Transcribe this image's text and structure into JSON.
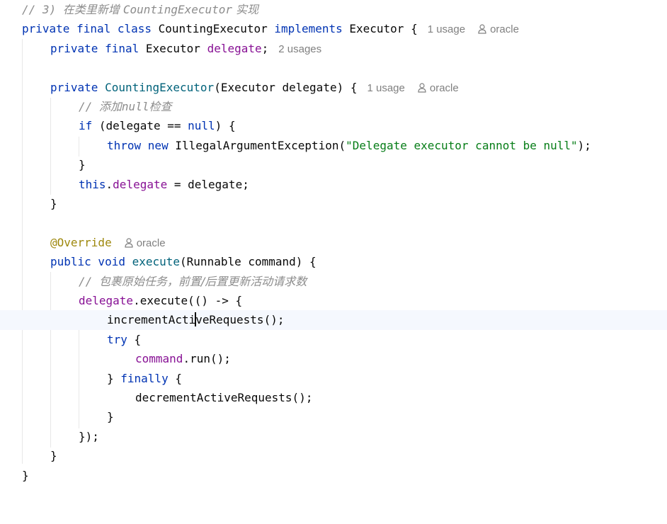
{
  "editor": {
    "lines": [
      {
        "comment": "// 3) ",
        "comment_zh_1": "在类里新增 ",
        "comment_en": "CountingExecutor",
        "comment_zh_2": " 实现"
      },
      {
        "kw1": "private final class ",
        "name": "CountingExecutor",
        "kw2": " implements ",
        "iface": "Executor",
        "brace": " {",
        "usages": "1 usage",
        "author": "oracle"
      },
      {
        "kw": "private final ",
        "type": "Executor",
        "field": "delegate",
        "semi": ";",
        "usages": "2 usages"
      },
      {},
      {
        "kw": "private ",
        "ctor": "CountingExecutor",
        "params": "(Executor delegate) {",
        "usages": "1 usage",
        "author": "oracle"
      },
      {
        "comment": "// ",
        "comment_zh_1": "添加",
        "comment_en": "null",
        "comment_zh_2": "检查"
      },
      {
        "kw": "if ",
        "p1": "(delegate == ",
        "null": "null",
        "p2": ") {"
      },
      {
        "kw": "throw new ",
        "cls": "IllegalArgumentException(",
        "str": "\"Delegate executor cannot be null\"",
        "end": ");"
      },
      {
        "text": "}"
      },
      {
        "kw": "this",
        "dot": ".",
        "field": "delegate",
        "rest": " = delegate;"
      },
      {
        "text": "}"
      },
      {},
      {
        "annotation": "@Override",
        "author": "oracle"
      },
      {
        "kw": "public void ",
        "fn": "execute",
        "params": "(Runnable command) {"
      },
      {
        "comment": "// ",
        "comment_zh": "包裹原始任务，前置/后置更新活动请求数"
      },
      {
        "field": "delegate",
        "rest": ".execute(() -> {"
      },
      {
        "before_caret": "incrementActi",
        "after_caret": "veRequests();"
      },
      {
        "kw": "try",
        "rest": " {"
      },
      {
        "field": "command",
        "rest": ".run();"
      },
      {
        "text1": "} ",
        "kw": "finally",
        "text2": " {"
      },
      {
        "text": "decrementActiveRequests();"
      },
      {
        "text": "}"
      },
      {
        "text": "});"
      },
      {
        "text": "}"
      },
      {
        "text": "}"
      }
    ]
  },
  "colors": {
    "keyword": "#0033b3",
    "function": "#00627a",
    "field": "#871094",
    "string": "#067d17",
    "comment": "#8c8c8c",
    "annotation": "#9e880d",
    "hint": "#808080",
    "current_line": "#f5f8fe"
  },
  "icons": {
    "author_hint": "person-icon"
  }
}
